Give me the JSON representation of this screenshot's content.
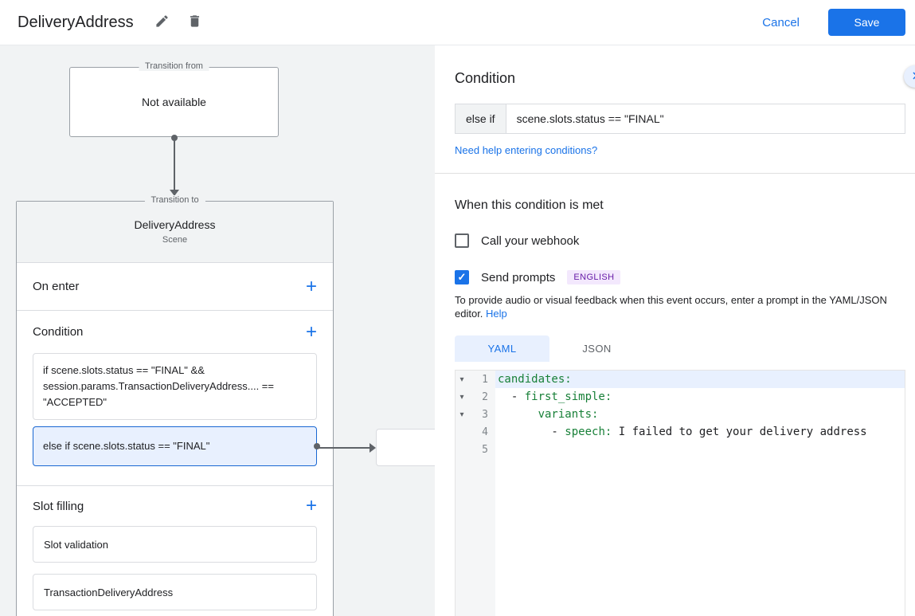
{
  "colors": {
    "accent": "#1a73e8",
    "selected_bg": "#e8f0fe",
    "badge_bg": "#f3e8fd",
    "badge_text": "#681da8",
    "code_key": "#188038"
  },
  "header": {
    "title": "DeliveryAddress",
    "cancel_label": "Cancel",
    "save_label": "Save"
  },
  "canvas": {
    "transition_from": {
      "label": "Transition from",
      "content": "Not available"
    },
    "transition_to": {
      "label": "Transition to",
      "title": "DeliveryAddress",
      "subtitle": "Scene",
      "on_enter_label": "On enter",
      "condition_label": "Condition",
      "slot_filling_label": "Slot filling",
      "add_icon": "+",
      "conditions": [
        {
          "text": "if scene.slots.status == \"FINAL\" && session.params.TransactionDeliveryAddress.... == \"ACCEPTED\"",
          "selected": false
        },
        {
          "text": "else if scene.slots.status == \"FINAL\"",
          "selected": true
        }
      ],
      "slots": [
        "Slot validation",
        "TransactionDeliveryAddress"
      ]
    }
  },
  "panel": {
    "title": "Condition",
    "condition_prefix": "else if",
    "condition_value": "scene.slots.status == \"FINAL\"",
    "help_link": "Need help entering conditions?",
    "when_met": {
      "title": "When this condition is met",
      "webhook_label": "Call your webhook",
      "webhook_checked": false,
      "prompts_label": "Send prompts",
      "prompts_checked": true,
      "check_icon": "✓",
      "language_badge": "ENGLISH",
      "description": "To provide audio or visual feedback when this event occurs, enter a prompt in the YAML/JSON editor.",
      "description_link": "Help"
    },
    "tabs": [
      {
        "label": "YAML",
        "active": true
      },
      {
        "label": "JSON",
        "active": false
      }
    ],
    "editor": {
      "fold_icon": "▾",
      "lines": [
        {
          "number": "1",
          "fold": true,
          "highlight": true,
          "segments": [
            {
              "t": "candidates:",
              "c": "key"
            }
          ]
        },
        {
          "number": "2",
          "fold": true,
          "highlight": false,
          "segments": [
            {
              "t": "  - ",
              "c": "plain"
            },
            {
              "t": "first_simple:",
              "c": "key"
            }
          ]
        },
        {
          "number": "3",
          "fold": true,
          "highlight": false,
          "segments": [
            {
              "t": "      ",
              "c": "plain"
            },
            {
              "t": "variants:",
              "c": "key"
            }
          ]
        },
        {
          "number": "4",
          "fold": false,
          "highlight": false,
          "segments": [
            {
              "t": "        - ",
              "c": "plain"
            },
            {
              "t": "speech:",
              "c": "key"
            },
            {
              "t": " I failed to get your delivery address",
              "c": "val"
            }
          ]
        },
        {
          "number": "5",
          "fold": false,
          "highlight": false,
          "segments": []
        }
      ]
    }
  }
}
